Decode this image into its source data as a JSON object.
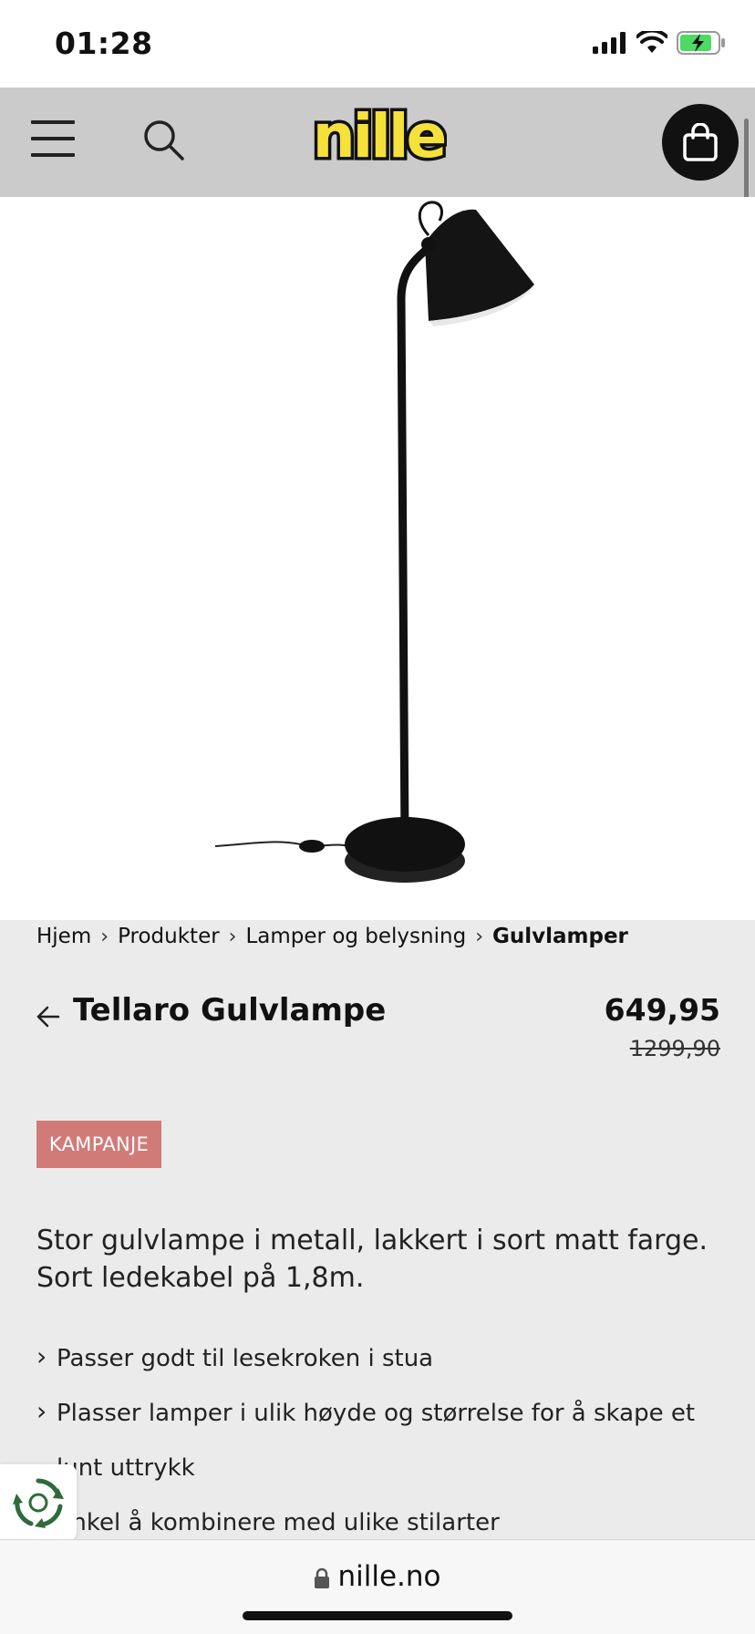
{
  "status_bar": {
    "time": "01:28"
  },
  "header": {
    "logo_text": "nille",
    "menu_icon": "hamburger-menu-icon",
    "search_icon": "search-icon",
    "cart_icon": "shopping-bag-icon"
  },
  "breadcrumb": {
    "items": [
      "Hjem",
      "Produkter",
      "Lamper og belysning"
    ],
    "current": "Gulvlamper"
  },
  "product": {
    "title": "Tellaro Gulvlampe",
    "price": "649,95",
    "old_price": "1299,90",
    "badge": "KAMPANJE",
    "description_lines": [
      "Stor gulvlampe i metall, lakkert i sort matt farge.",
      "Sort ledekabel på 1,8m."
    ],
    "features": [
      "Passer godt til lesekroken i stua",
      "Plasser lamper i ulik høyde og størrelse for å skape et",
      "lunt uttrykk",
      "Enkel å kombinere med ulike stilarter"
    ]
  },
  "browser": {
    "url": "nille.no"
  },
  "colors": {
    "header_bg": "#cbcbcb",
    "logo_yellow": "#f5e13a",
    "badge_bg": "#d17b79",
    "page_bg": "#ebebeb"
  }
}
